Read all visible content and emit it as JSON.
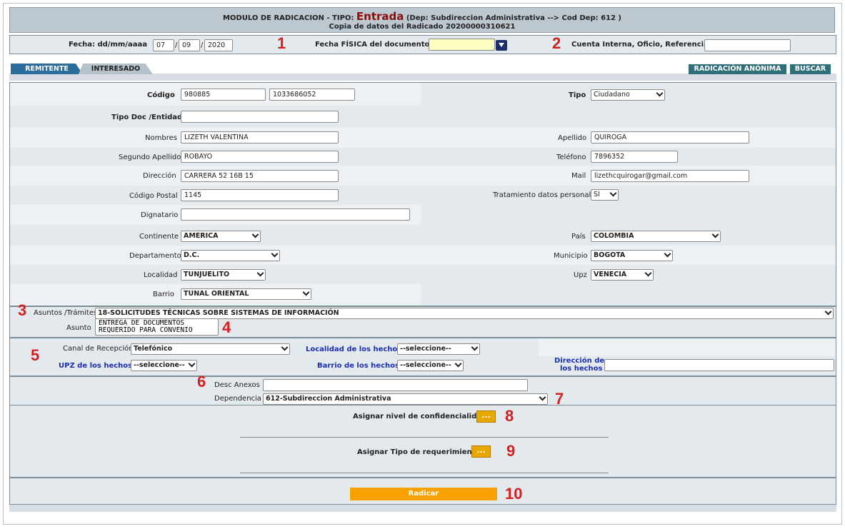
{
  "header": {
    "line1_prefix": "MODULO DE RADICACION - TIPO:",
    "tipo": "Entrada",
    "line1_suffix": "(Dep: Subdireccion Administrativa --> Cod Dep: 612 )",
    "line2": "Copia de datos del Radicado 20200000310621"
  },
  "fecha_row": {
    "fecha_label": "Fecha: dd/mm/aaaa",
    "day": "07",
    "month": "09",
    "year": "2020",
    "sep": "/",
    "fisica_label": "Fecha FÍSICA del documento",
    "fisica_value": "",
    "cuenta_label": "Cuenta Interna, Oficio, Referencia",
    "cuenta_value": ""
  },
  "tabs": {
    "remitente": "REMITENTE",
    "interesado": "INTERESADO"
  },
  "actions": {
    "anonima": "RADICACIÓN ANÓNIMA",
    "buscar": "BUSCAR"
  },
  "form": {
    "codigo_label": "Código",
    "codigo1": "980885",
    "codigo2": "1033686052",
    "tipo_label": "Tipo",
    "tipo_value": "Ciudadano",
    "tipo_doc_label": "Tipo Doc /Entidad",
    "tipo_doc_value": "",
    "nombres_label": "Nombres",
    "nombres_value": "LIZETH VALENTINA",
    "apellido_label": "Apellido",
    "apellido_value": "QUIROGA",
    "segundo_label": "Segundo Apellido",
    "segundo_value": "ROBAYO",
    "telefono_label": "Teléfono",
    "telefono_value": "7896352",
    "direccion_label": "Dirección",
    "direccion_value": "CARRERA 52 16B 15",
    "mail_label": "Mail",
    "mail_value": "lizethcquirogar@gmail.com",
    "postal_label": "Código Postal",
    "postal_value": "1145",
    "tratamiento_label": "Tratamiento datos personales",
    "tratamiento_value": "SI",
    "dignatario_label": "Dignatario",
    "dignatario_value": "",
    "continente_label": "Continente",
    "continente_value": "AMERICA",
    "pais_label": "País",
    "pais_value": "COLOMBIA",
    "departamento_label": "Departamento",
    "departamento_value": "D.C.",
    "municipio_label": "Municipio",
    "municipio_value": "BOGOTA",
    "localidad_label": "Localidad",
    "localidad_value": "TUNJUELITO",
    "upz_label": "Upz",
    "upz_value": "VENECIA",
    "barrio_label": "Barrio",
    "barrio_value": "TUNAL ORIENTAL"
  },
  "asuntos": {
    "tramites_label": "Asuntos /Trámites",
    "tramites_value": "18-SOLICITUDES TÉCNICAS SOBRE SISTEMAS DE INFORMACIÓN",
    "asunto_label": "Asunto",
    "asunto_value": "ENTREGA DE DOCUMENTOS REQUERIDO PARA CONVENIO"
  },
  "recepcion": {
    "canal_label": "Canal de Recepción",
    "canal_value": "Telefónico",
    "localidad_hechos_label": "Localidad de los hechos",
    "localidad_hechos_value": "--seleccione--",
    "upz_hechos_label": "UPZ de los hechos",
    "upz_hechos_value": "--seleccione--",
    "barrio_hechos_label": "Barrio de los hechos",
    "barrio_hechos_value": "--seleccione--",
    "direccion_hechos_label1": "Dirección de",
    "direccion_hechos_label2": "los hechos",
    "direccion_hechos_value": ""
  },
  "anexos": {
    "desc_label": "Desc Anexos",
    "desc_value": "",
    "dependencia_label": "Dependencia",
    "dependencia_value": "612-Subdireccion Administrativa"
  },
  "confidencialidad": {
    "label": "Asignar nivel de confidencialidad:",
    "button": "..."
  },
  "requerimiento": {
    "label": "Asignar Tipo de requerimiento:",
    "button": "..."
  },
  "submit": {
    "label": "Radicar"
  },
  "markers": [
    "1",
    "2",
    "3",
    "4",
    "5",
    "6",
    "7",
    "8",
    "9",
    "10"
  ],
  "colors": {
    "tipo_red": "#8a0f0f",
    "marker_red": "#d32020",
    "tab_blue": "#2c6d9d",
    "submit_orange": "#f7a000",
    "button_yellow": "#e9a800"
  }
}
